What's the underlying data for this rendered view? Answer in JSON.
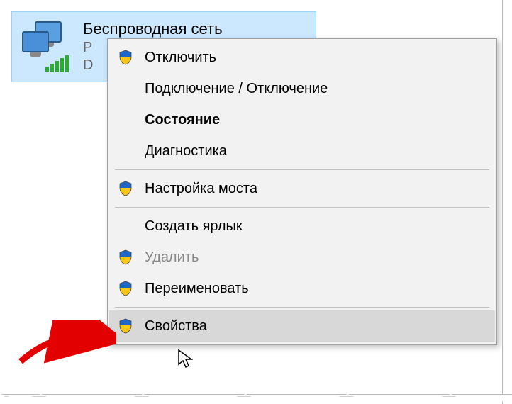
{
  "network": {
    "title": "Беспроводная сеть",
    "line2_visible": "P",
    "line3_visible": "D"
  },
  "menu": {
    "items": [
      {
        "label": "Отключить",
        "shield": true,
        "bold": false,
        "disabled": false,
        "hover": false
      },
      {
        "label": "Подключение / Отключение",
        "shield": false,
        "bold": false,
        "disabled": false,
        "hover": false
      },
      {
        "label": "Состояние",
        "shield": false,
        "bold": true,
        "disabled": false,
        "hover": false
      },
      {
        "label": "Диагностика",
        "shield": false,
        "bold": false,
        "disabled": false,
        "hover": false
      },
      {
        "sep": true
      },
      {
        "label": "Настройка моста",
        "shield": true,
        "bold": false,
        "disabled": false,
        "hover": false
      },
      {
        "sep": true
      },
      {
        "label": "Создать ярлык",
        "shield": false,
        "bold": false,
        "disabled": false,
        "hover": false
      },
      {
        "label": "Удалить",
        "shield": true,
        "bold": false,
        "disabled": true,
        "hover": false
      },
      {
        "label": "Переименовать",
        "shield": true,
        "bold": false,
        "disabled": false,
        "hover": false
      },
      {
        "sep": true
      },
      {
        "label": "Свойства",
        "shield": true,
        "bold": false,
        "disabled": false,
        "hover": true
      }
    ]
  },
  "colors": {
    "selection_bg": "#cce8ff",
    "selection_border": "#99d1ff",
    "arrow": "#e20000"
  }
}
